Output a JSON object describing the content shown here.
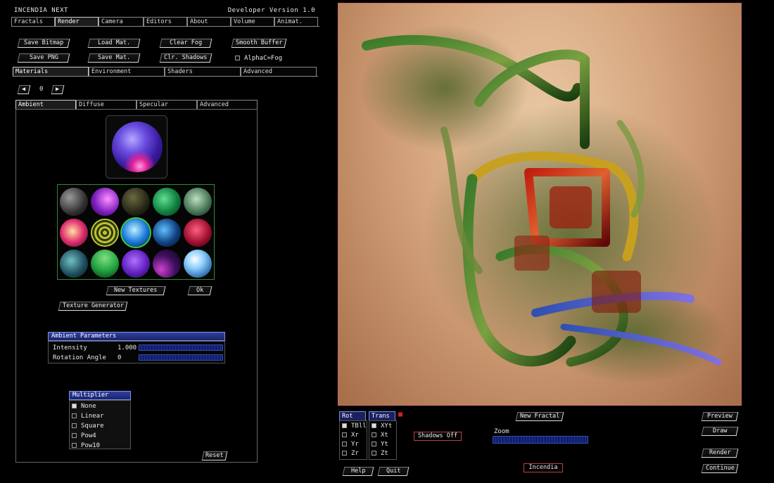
{
  "app": {
    "title": "INCENDIA NEXT",
    "version": "Developer Version 1.0"
  },
  "main_tabs": [
    "Fractals",
    "Render",
    "Camera",
    "Editors",
    "About",
    "Volume",
    "Animat."
  ],
  "toolbar": {
    "save_bitmap": "Save Bitmap",
    "load_mat": "Load Mat.",
    "clear_fog": "Clear Fog",
    "smooth_buffer": "Smooth Buffer",
    "save_png": "Save PNG",
    "save_mat": "Save Mat.",
    "clr_shadows": "Clr. Shadows",
    "alpha_fog": "AlphaC=Fog"
  },
  "sub_tabs": [
    "Materials",
    "Environment",
    "Shaders",
    "Advanced"
  ],
  "material_index": "0",
  "material_tabs": [
    "Ambient",
    "Diffuse",
    "Specular",
    "Advanced"
  ],
  "texture_buttons": {
    "new_textures": "New Textures",
    "ok": "Ok",
    "texture_generator": "Texture Generator"
  },
  "ambient_params": {
    "header": "Ambient Parameters",
    "intensity_label": "Intensity",
    "intensity_value": "1.000",
    "rotation_label": "Rotation Angle",
    "rotation_value": "0"
  },
  "multiplier": {
    "header": "Multiplier",
    "options": [
      "None",
      "Linear",
      "Square",
      "Pow4",
      "Pow10"
    ],
    "selected": "None"
  },
  "reset_label": "Reset",
  "bottom": {
    "rot_tab": "Rot",
    "trans_tab": "Trans",
    "rot_options": [
      "TBll",
      "Xr",
      "Yr",
      "Zr"
    ],
    "trans_options": [
      "XYt",
      "Xt",
      "Yt",
      "Zt"
    ],
    "shadows_off": "Shadows Off",
    "new_fractal": "New Fractal",
    "zoom_label": "Zoom",
    "incendia": "Incendia",
    "help": "Help",
    "quit": "Quit",
    "preview": "Preview",
    "draw": "Draw",
    "render": "Render",
    "continue": "Continue"
  },
  "colors": {
    "accent_blue": "#3040a0",
    "render_border": "#c76e6e",
    "lock_red": "#d02020"
  }
}
